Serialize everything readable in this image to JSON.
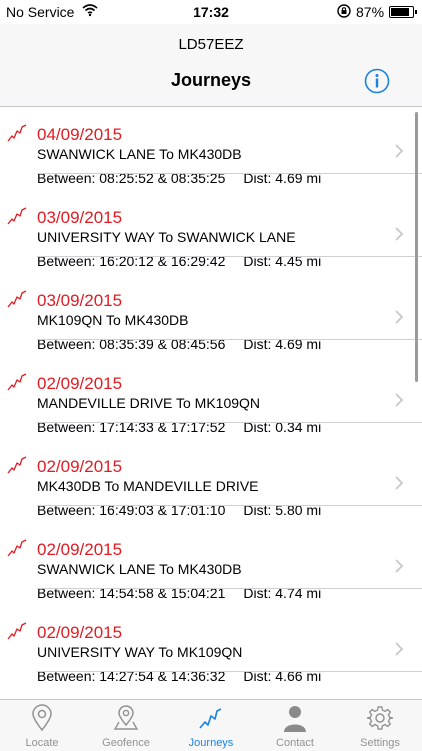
{
  "status_bar": {
    "carrier": "No Service",
    "time": "17:32",
    "battery": "87%",
    "battery_level": 0.87
  },
  "nav": {
    "subtitle": "LD57EEZ",
    "title": "Journeys",
    "info_icon": "info-circle-icon"
  },
  "colors": {
    "date_red": "#e21b23",
    "tab_active": "#1a82e2",
    "tab_inactive": "#929292"
  },
  "journeys": [
    {
      "date": "04/09/2015",
      "route": "SWANWICK LANE  To  MK430DB",
      "between": "Between: 08:25:52 & 08:35:25",
      "dist": "Dist: 4.69 mi"
    },
    {
      "date": "03/09/2015",
      "route": "UNIVERSITY WAY  To  SWANWICK LANE",
      "between": "Between: 16:20:12 & 16:29:42",
      "dist": "Dist: 4.45 mi"
    },
    {
      "date": "03/09/2015",
      "route": "MK109QN To  MK430DB",
      "between": "Between: 08:35:39 & 08:45:56",
      "dist": "Dist: 4.69 mi"
    },
    {
      "date": "02/09/2015",
      "route": "MANDEVILLE DRIVE  To  MK109QN",
      "between": "Between: 17:14:33 & 17:17:52",
      "dist": "Dist: 0.34 mi"
    },
    {
      "date": "02/09/2015",
      "route": "MK430DB To  MANDEVILLE DRIVE",
      "between": "Between: 16:49:03 & 17:01:10",
      "dist": "Dist: 5.80 mi"
    },
    {
      "date": "02/09/2015",
      "route": "SWANWICK LANE  To  MK430DB",
      "between": "Between: 14:54:58 & 15:04:21",
      "dist": "Dist: 4.74 mi"
    },
    {
      "date": "02/09/2015",
      "route": "UNIVERSITY WAY  To  MK109QN",
      "between": "Between: 14:27:54 & 14:36:32",
      "dist": "Dist: 4.66 mi"
    }
  ],
  "tabs": [
    {
      "label": "Locate",
      "icon": "map-pin-icon",
      "active": false
    },
    {
      "label": "Geofence",
      "icon": "geofence-pin-icon",
      "active": false
    },
    {
      "label": "Journeys",
      "icon": "journey-route-icon",
      "active": true
    },
    {
      "label": "Contact",
      "icon": "person-icon",
      "active": false
    },
    {
      "label": "Settings",
      "icon": "gear-icon",
      "active": false
    }
  ]
}
